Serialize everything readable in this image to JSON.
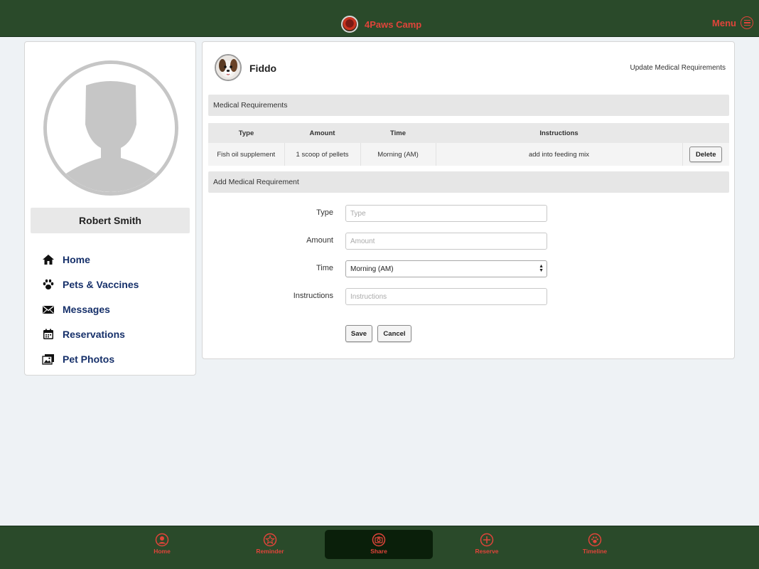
{
  "header": {
    "app_name": "4Paws Camp",
    "menu_label": "Menu",
    "brand_color": "#e0443a",
    "bar_color": "#2a4a2a"
  },
  "profile": {
    "user_name": "Robert Smith"
  },
  "sidebar": {
    "items": [
      {
        "label": "Home",
        "icon": "home-icon"
      },
      {
        "label": "Pets & Vaccines",
        "icon": "paw-icon"
      },
      {
        "label": "Messages",
        "icon": "envelope-icon"
      },
      {
        "label": "Reservations",
        "icon": "calendar-icon"
      },
      {
        "label": "Pet Photos",
        "icon": "photos-icon"
      }
    ]
  },
  "pet": {
    "name": "Fiddo",
    "action_link": "Update Medical Requirements"
  },
  "medical_requirements": {
    "section_title": "Medical Requirements",
    "columns": [
      "Type",
      "Amount",
      "Time",
      "Instructions"
    ],
    "rows": [
      {
        "type": "Fish oil supplement",
        "amount": "1 scoop of pellets",
        "time": "Morning (AM)",
        "instructions": "add into feeding mix",
        "action": "Delete"
      }
    ]
  },
  "add_form": {
    "section_title": "Add Medical Requirement",
    "type_label": "Type",
    "type_placeholder": "Type",
    "amount_label": "Amount",
    "amount_placeholder": "Amount",
    "time_label": "Time",
    "time_value": "Morning (AM)",
    "instructions_label": "Instructions",
    "instructions_placeholder": "Instructions",
    "save_label": "Save",
    "cancel_label": "Cancel"
  },
  "bottom_nav": {
    "tabs": [
      {
        "label": "Home",
        "icon": "user-circle-icon"
      },
      {
        "label": "Reminder",
        "icon": "star-icon"
      },
      {
        "label": "Share",
        "icon": "camera-icon",
        "active": true
      },
      {
        "label": "Reserve",
        "icon": "plus-circle-icon"
      },
      {
        "label": "Timeline",
        "icon": "paw-circle-icon"
      }
    ]
  }
}
